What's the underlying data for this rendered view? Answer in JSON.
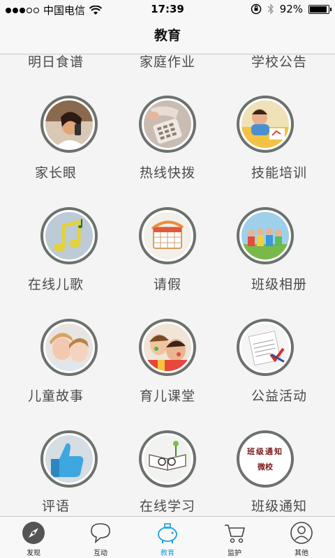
{
  "status_bar": {
    "carrier": "中国电信",
    "time": "17:39",
    "battery": "92%",
    "battery_level": 0.92
  },
  "nav": {
    "title": "教育"
  },
  "grid": {
    "partial_row": [
      "明日食谱",
      "家庭作业",
      "学校公告"
    ],
    "items": [
      {
        "label": "家长眼",
        "icon": "woman-phone-photo"
      },
      {
        "label": "热线快拨",
        "icon": "telephone-photo"
      },
      {
        "label": "技能培训",
        "icon": "child-drawing-photo"
      },
      {
        "label": "在线儿歌",
        "icon": "music-note-icon"
      },
      {
        "label": "请假",
        "icon": "calendar-icon"
      },
      {
        "label": "班级相册",
        "icon": "class-group-photo"
      },
      {
        "label": "儿童故事",
        "icon": "mother-child-photo"
      },
      {
        "label": "育儿课堂",
        "icon": "children-painting-photo"
      },
      {
        "label": "公益活动",
        "icon": "certificate-icon"
      },
      {
        "label": "评语",
        "icon": "thumbs-up-icon"
      },
      {
        "label": "在线学习",
        "icon": "book-glasses-icon"
      },
      {
        "label": "班级通知",
        "icon": "class-notice-icon"
      }
    ],
    "class_notice_text": [
      "班级通知",
      "微校"
    ]
  },
  "tabs": [
    {
      "label": "发现",
      "icon": "compass-icon",
      "active": false
    },
    {
      "label": "互动",
      "icon": "chat-bubble-icon",
      "active": false
    },
    {
      "label": "教育",
      "icon": "piggy-bank-icon",
      "active": true
    },
    {
      "label": "监护",
      "icon": "cart-icon",
      "active": false
    },
    {
      "label": "其他",
      "icon": "user-icon",
      "active": false
    }
  ],
  "colors": {
    "accent": "#1aa0d8",
    "circle_border": "#6b716c",
    "background": "#f4f4f4"
  }
}
